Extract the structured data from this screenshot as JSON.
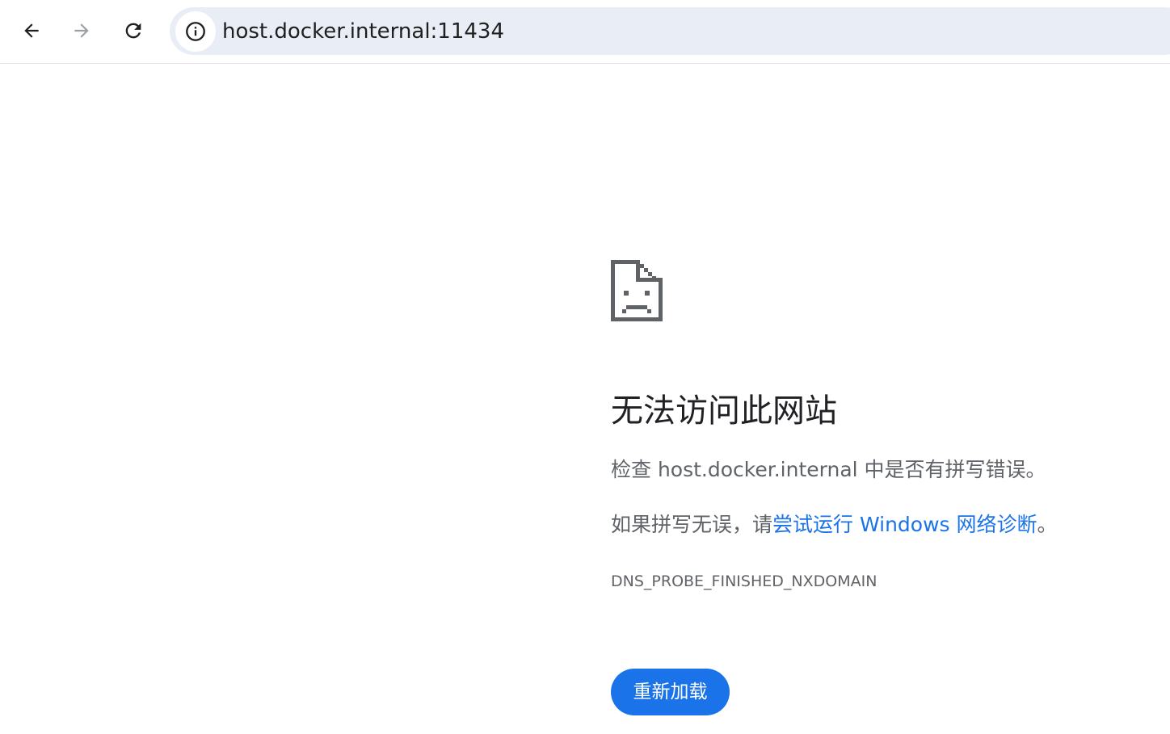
{
  "toolbar": {
    "url": "host.docker.internal:11434",
    "icons": {
      "back": "back-arrow-icon",
      "forward": "forward-arrow-icon",
      "reload": "reload-icon",
      "site_info": "info-icon"
    }
  },
  "error_page": {
    "icon": "sad-document-icon",
    "title": "无法访问此网站",
    "check_prefix": "检查 ",
    "check_host": "host.docker.internal",
    "check_suffix": " 中是否有拼写错误。",
    "suggest_prefix": "如果拼写无误，请",
    "suggest_link": "尝试运行 Windows 网络诊断",
    "suggest_suffix": "。",
    "error_code": "DNS_PROBE_FINISHED_NXDOMAIN",
    "reload_button": "重新加载"
  },
  "colors": {
    "accent": "#1a73e8",
    "omnibox_bg": "#e9eef6",
    "text_primary": "#202124",
    "text_secondary": "#5f6368"
  }
}
